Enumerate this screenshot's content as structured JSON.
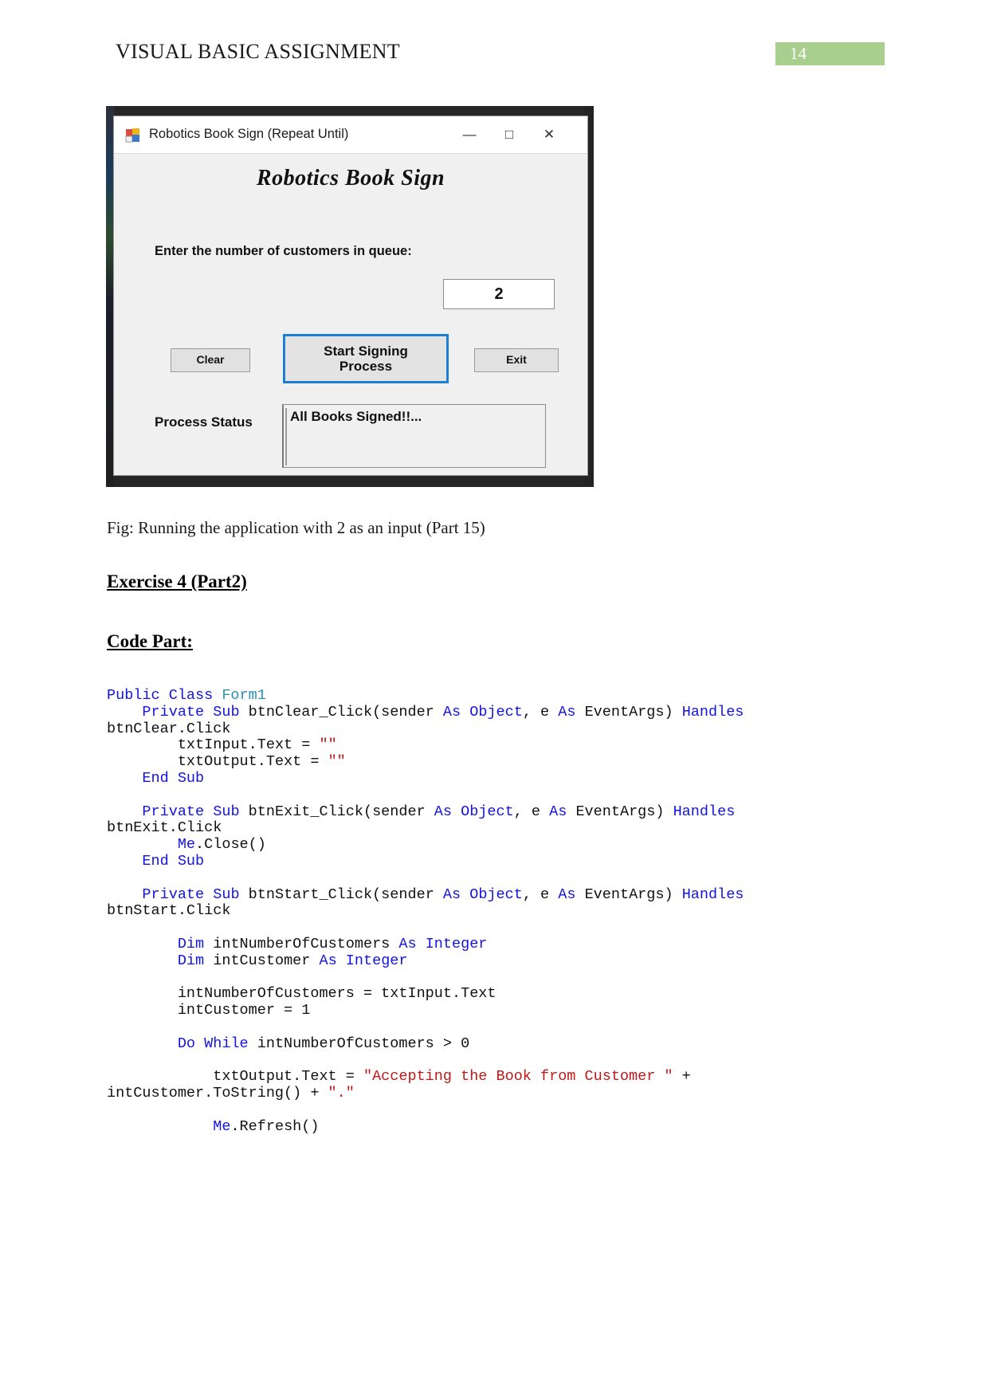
{
  "header": {
    "title": "VISUAL BASIC ASSIGNMENT",
    "page_number": "14",
    "badge_color": "#a9cf8f"
  },
  "figure": {
    "caption": "Fig: Running the application with 2 as an input (Part 15)",
    "window": {
      "title": "Robotics Book Sign (Repeat Until)",
      "icon": "vb-form-icon",
      "minimize_glyph": "—",
      "maximize_glyph": "□",
      "close_glyph": "✕",
      "heading": "Robotics Book Sign",
      "prompt_label": "Enter the number of customers in queue:",
      "input_value": "2",
      "buttons": {
        "clear": "Clear",
        "start": "Start Signing\nProcess",
        "start_line1": "Start Signing",
        "start_line2": "Process",
        "exit": "Exit"
      },
      "status_label": "Process Status",
      "status_value": "All Books Signed!!...",
      "focus_color": "#1b7fd4"
    }
  },
  "sections": {
    "exercise_heading": "Exercise 4 (Part2)",
    "code_heading": "Code Part:"
  },
  "code": {
    "language": "vb",
    "lines": [
      [
        {
          "t": "Public Class ",
          "c": "kw"
        },
        {
          "t": "Form1",
          "c": "ty"
        }
      ],
      [
        {
          "t": "    ",
          "c": "pl"
        },
        {
          "t": "Private Sub ",
          "c": "kw"
        },
        {
          "t": "btnClear_Click(sender ",
          "c": "pl"
        },
        {
          "t": "As Object",
          "c": "kw"
        },
        {
          "t": ", e ",
          "c": "pl"
        },
        {
          "t": "As ",
          "c": "kw"
        },
        {
          "t": "EventArgs) ",
          "c": "pl"
        },
        {
          "t": "Handles",
          "c": "kw"
        }
      ],
      [
        {
          "t": "btnClear.Click",
          "c": "pl"
        }
      ],
      [
        {
          "t": "        txtInput.Text = ",
          "c": "pl"
        },
        {
          "t": "\"\"",
          "c": "st"
        }
      ],
      [
        {
          "t": "        txtOutput.Text = ",
          "c": "pl"
        },
        {
          "t": "\"\"",
          "c": "st"
        }
      ],
      [
        {
          "t": "    ",
          "c": "pl"
        },
        {
          "t": "End Sub",
          "c": "kw"
        }
      ],
      [
        {
          "t": "",
          "c": "pl"
        }
      ],
      [
        {
          "t": "    ",
          "c": "pl"
        },
        {
          "t": "Private Sub ",
          "c": "kw"
        },
        {
          "t": "btnExit_Click(sender ",
          "c": "pl"
        },
        {
          "t": "As Object",
          "c": "kw"
        },
        {
          "t": ", e ",
          "c": "pl"
        },
        {
          "t": "As ",
          "c": "kw"
        },
        {
          "t": "EventArgs) ",
          "c": "pl"
        },
        {
          "t": "Handles",
          "c": "kw"
        }
      ],
      [
        {
          "t": "btnExit.Click",
          "c": "pl"
        }
      ],
      [
        {
          "t": "        ",
          "c": "pl"
        },
        {
          "t": "Me",
          "c": "kw"
        },
        {
          "t": ".Close()",
          "c": "pl"
        }
      ],
      [
        {
          "t": "    ",
          "c": "pl"
        },
        {
          "t": "End Sub",
          "c": "kw"
        }
      ],
      [
        {
          "t": "",
          "c": "pl"
        }
      ],
      [
        {
          "t": "    ",
          "c": "pl"
        },
        {
          "t": "Private Sub ",
          "c": "kw"
        },
        {
          "t": "btnStart_Click(sender ",
          "c": "pl"
        },
        {
          "t": "As Object",
          "c": "kw"
        },
        {
          "t": ", e ",
          "c": "pl"
        },
        {
          "t": "As ",
          "c": "kw"
        },
        {
          "t": "EventArgs) ",
          "c": "pl"
        },
        {
          "t": "Handles",
          "c": "kw"
        }
      ],
      [
        {
          "t": "btnStart.Click",
          "c": "pl"
        }
      ],
      [
        {
          "t": "",
          "c": "pl"
        }
      ],
      [
        {
          "t": "        ",
          "c": "pl"
        },
        {
          "t": "Dim ",
          "c": "kw"
        },
        {
          "t": "intNumberOfCustomers ",
          "c": "pl"
        },
        {
          "t": "As Integer",
          "c": "kw"
        }
      ],
      [
        {
          "t": "        ",
          "c": "pl"
        },
        {
          "t": "Dim ",
          "c": "kw"
        },
        {
          "t": "intCustomer ",
          "c": "pl"
        },
        {
          "t": "As Integer",
          "c": "kw"
        }
      ],
      [
        {
          "t": "",
          "c": "pl"
        }
      ],
      [
        {
          "t": "        intNumberOfCustomers = txtInput.Text",
          "c": "pl"
        }
      ],
      [
        {
          "t": "        intCustomer = 1",
          "c": "pl"
        }
      ],
      [
        {
          "t": "",
          "c": "pl"
        }
      ],
      [
        {
          "t": "        ",
          "c": "pl"
        },
        {
          "t": "Do While ",
          "c": "kw"
        },
        {
          "t": "intNumberOfCustomers > 0",
          "c": "pl"
        }
      ],
      [
        {
          "t": "",
          "c": "pl"
        }
      ],
      [
        {
          "t": "            txtOutput.Text = ",
          "c": "pl"
        },
        {
          "t": "\"Accepting the Book from Customer \"",
          "c": "st"
        },
        {
          "t": " +",
          "c": "pl"
        }
      ],
      [
        {
          "t": "intCustomer.ToString() + ",
          "c": "pl"
        },
        {
          "t": "\".\"",
          "c": "st"
        }
      ],
      [
        {
          "t": "",
          "c": "pl"
        }
      ],
      [
        {
          "t": "            ",
          "c": "pl"
        },
        {
          "t": "Me",
          "c": "kw"
        },
        {
          "t": ".Refresh()",
          "c": "pl"
        }
      ]
    ]
  }
}
